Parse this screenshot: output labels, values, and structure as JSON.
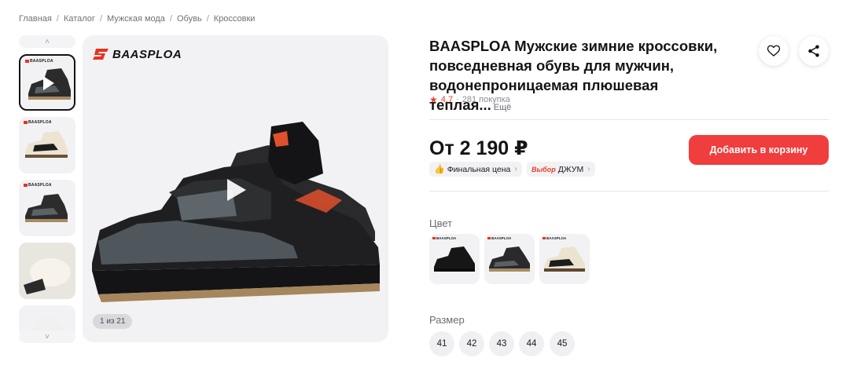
{
  "breadcrumb": [
    "Главная",
    "Каталог",
    "Мужская мода",
    "Обувь",
    "Кроссовки"
  ],
  "gallery": {
    "brand": "BAASPLOA",
    "counter": "1 из 21",
    "thumb_brand": "BAASPLOA"
  },
  "product": {
    "title": "BAASPLOA Мужские зимние кроссовки, повседневная обувь для мужчин, водонепроницаемая плюшевая теплая...",
    "more": "Ещё",
    "rating": "4,7",
    "rating_sep": "·",
    "purchases": "281 покупка"
  },
  "price": {
    "value": "От 2 190 ₽",
    "final_label": "Финальная цена",
    "choice_tag": "Выбор",
    "choice_label": "ДЖУМ"
  },
  "actions": {
    "add_to_cart": "Добавить в корзину",
    "favorite_icon": "heart-icon",
    "share_icon": "share-icon"
  },
  "color": {
    "label": "Цвет",
    "options_brand": "BAASPLOA"
  },
  "size": {
    "label": "Размер",
    "options": [
      "41",
      "42",
      "43",
      "44",
      "45"
    ]
  },
  "colors": {
    "accent": "#f03d3d",
    "rating": "#e8412c"
  }
}
